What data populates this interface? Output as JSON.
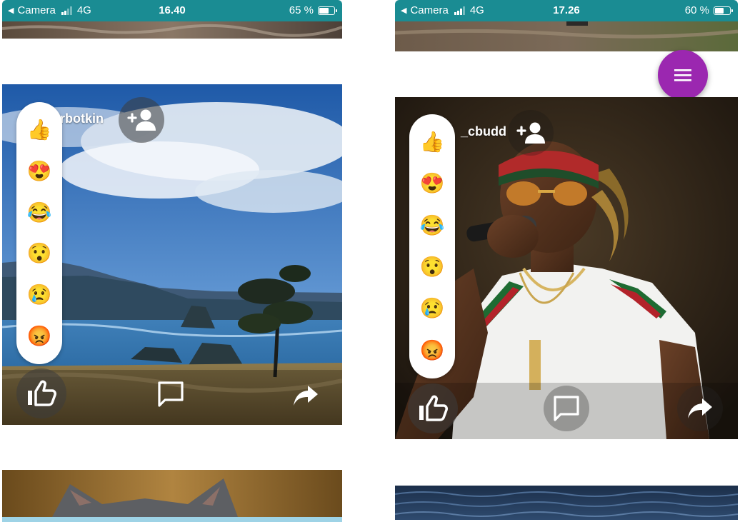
{
  "left_screen": {
    "status_bar": {
      "back_label": "Camera",
      "network": "4G",
      "time": "16.40",
      "battery": "65 %",
      "battery_level": 0.65
    },
    "post": {
      "username": "irbotkin"
    },
    "reactions": [
      "👍",
      "😍",
      "😂",
      "😯",
      "😢",
      "😡"
    ],
    "actions": {
      "like_icon": "thumb-up-icon",
      "comment_icon": "comment-icon",
      "share_icon": "share-icon"
    }
  },
  "right_screen": {
    "status_bar": {
      "back_label": "Camera",
      "network": "4G",
      "time": "17.26",
      "battery": "60 %",
      "battery_level": 0.6
    },
    "post": {
      "username": "_cbudd"
    },
    "reactions": [
      "👍",
      "😍",
      "😂",
      "😯",
      "😢",
      "😡"
    ],
    "actions": {
      "like_icon": "thumb-up-icon",
      "comment_icon": "comment-icon",
      "share_icon": "share-icon",
      "menu_icon": "menu-icon"
    }
  },
  "colors": {
    "status_bar": "#1a8c93",
    "fab": "#9b27b0"
  }
}
